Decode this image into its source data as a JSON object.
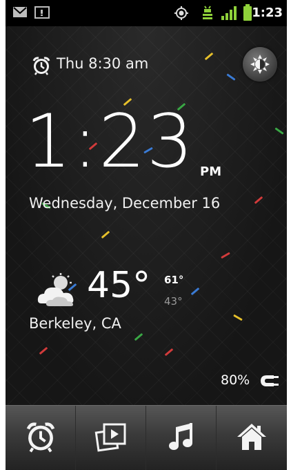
{
  "status_bar": {
    "time": "1:23",
    "icons": [
      "gmail-icon",
      "notification-icon",
      "gps-icon",
      "usb-debug-icon",
      "signal-icon",
      "battery-icon"
    ]
  },
  "alarm": {
    "next_alarm": "Thu 8:30 am",
    "icon": "alarm-clock-icon"
  },
  "brightness_button": {
    "icon": "brightness-icon"
  },
  "clock": {
    "time": "1:23",
    "ampm": "PM",
    "date": "Wednesday, December 16"
  },
  "weather": {
    "temperature": "45°",
    "high": "61°",
    "low": "43°",
    "location": "Berkeley, CA",
    "icon": "partly-cloudy-icon"
  },
  "battery": {
    "percent": "80%",
    "icon": "charging-plug-icon"
  },
  "dock": {
    "items": [
      {
        "name": "alarm",
        "icon": "alarm-clock-icon"
      },
      {
        "name": "gallery",
        "icon": "gallery-icon"
      },
      {
        "name": "music",
        "icon": "music-icon"
      },
      {
        "name": "home",
        "icon": "home-icon"
      }
    ]
  },
  "colors": {
    "background": "#141414",
    "text": "#ffffff",
    "low_temp": "#9a9a9a",
    "dock": "#3a3a3a",
    "signal_green": "#8fd13a",
    "confetti": [
      "#3a7bd5",
      "#d13b3b",
      "#e6c02b",
      "#3aa845"
    ]
  }
}
